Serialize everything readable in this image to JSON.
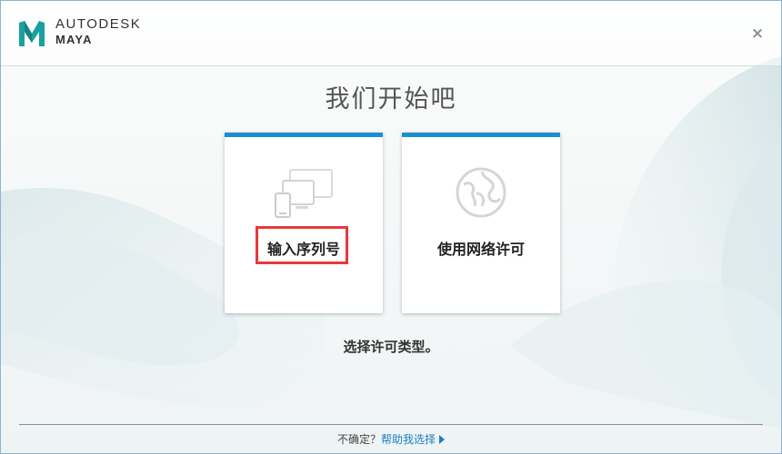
{
  "header": {
    "brand_line1": "AUTODESK",
    "brand_line2": "MAYA",
    "close_symbol": "×"
  },
  "main": {
    "title": "我们开始吧",
    "cards": [
      {
        "label": "输入序列号",
        "icon": "devices-icon"
      },
      {
        "label": "使用网络许可",
        "icon": "globe-icon"
      }
    ],
    "hint": "选择许可类型。"
  },
  "footer": {
    "question": "不确定？",
    "help_link": "帮助我选择"
  },
  "colors": {
    "accent": "#1a8fd2",
    "highlight": "#e8383b",
    "link": "#1a7fc6",
    "logo": "#1aa0a0"
  }
}
